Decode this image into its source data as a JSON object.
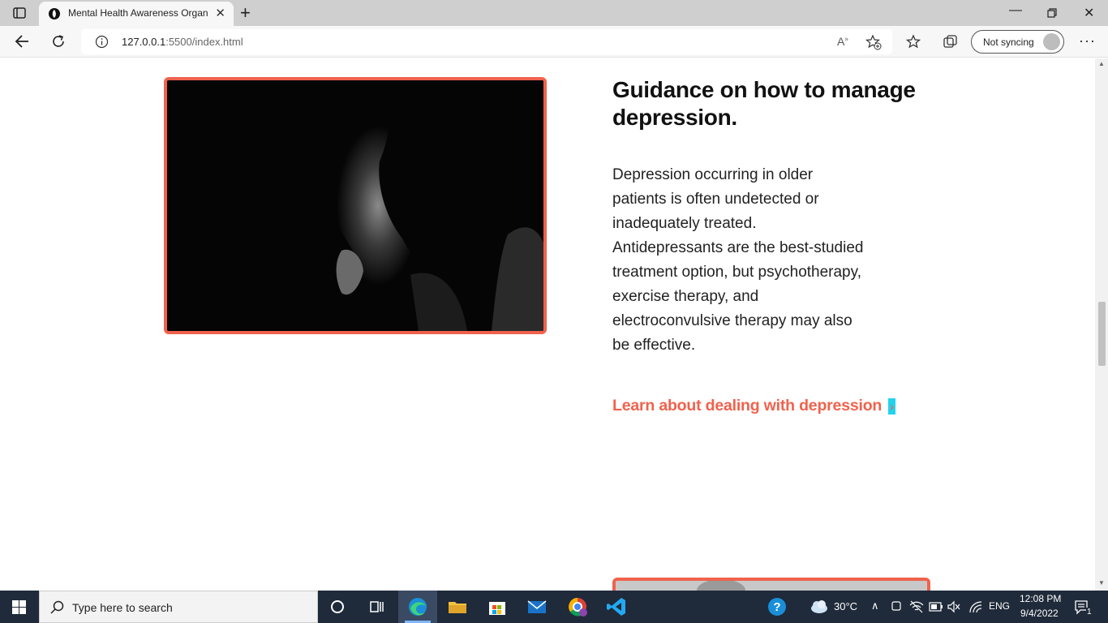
{
  "browser": {
    "tab_title": "Mental Health Awareness Organ",
    "url_host": "127.0.0.1",
    "url_rest": ":5500/index.html",
    "sync_label": "Not syncing"
  },
  "content": {
    "heading": "Guidance on how to manage depression.",
    "body": "Depression occurring in older patients is often undetected or inadequately treated. Antidepressants are the best-studied treatment option, but psychotherapy, exercise therapy, and electroconvulsive therapy may also be effective.",
    "link_label": "Learn about dealing with depression",
    "link_arrow": "›",
    "accent_color": "#f0624d"
  },
  "taskbar": {
    "search_placeholder": "Type here to search",
    "temperature": "30°C",
    "language": "ENG",
    "time": "12:08 PM",
    "date": "9/4/2022",
    "notification_count": "1"
  }
}
